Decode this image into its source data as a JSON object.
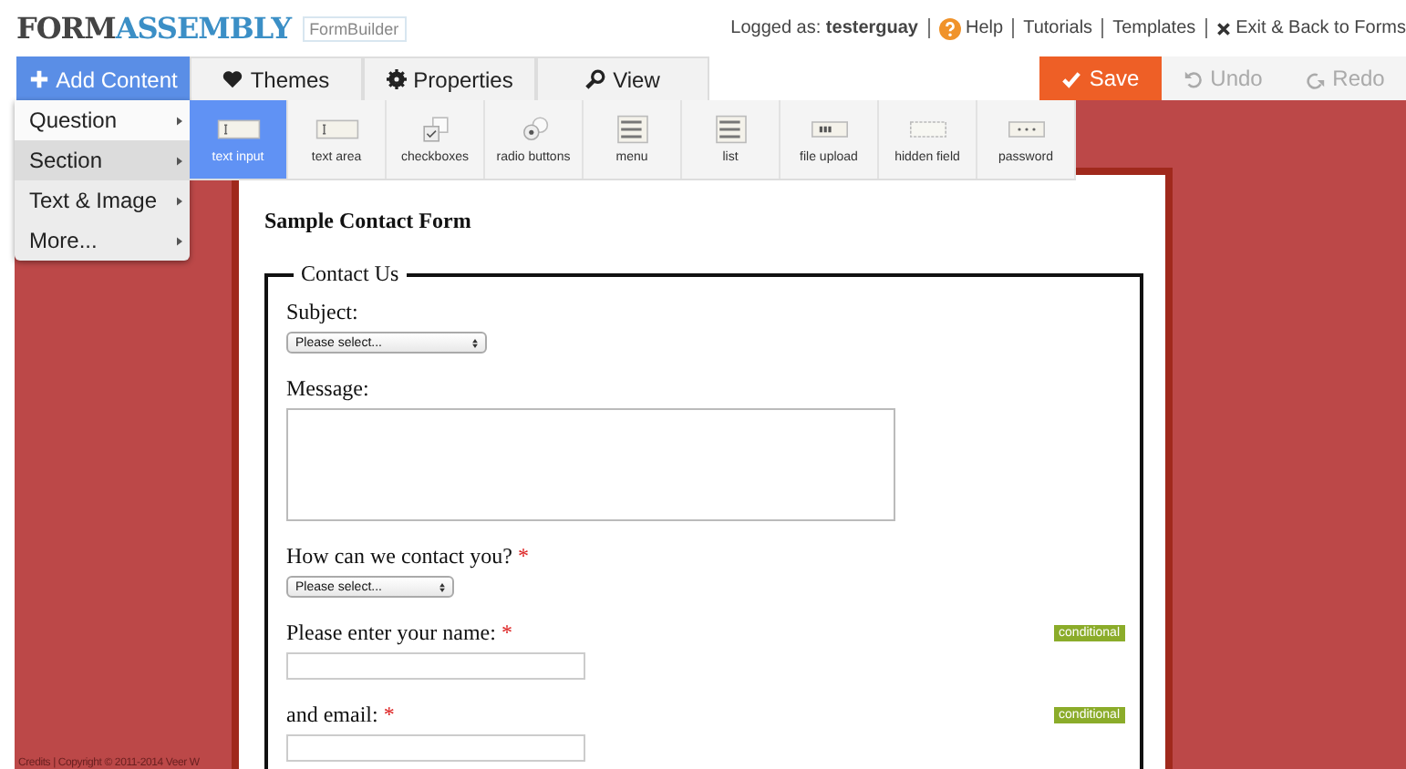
{
  "header": {
    "logo": {
      "dark": "FORM",
      "blue": "ASSEMBLY"
    },
    "product": "FormBuilder",
    "logged_as": "Logged as:",
    "username": "testerguay",
    "links": [
      {
        "label": "Help",
        "kind": "help"
      },
      {
        "label": "Tutorials",
        "kind": "plain"
      },
      {
        "label": "Templates",
        "kind": "plain"
      },
      {
        "label": "Exit & Back to Forms",
        "kind": "exit"
      }
    ]
  },
  "tabs": [
    {
      "label": "Add Content",
      "kind": "plus",
      "selected": true
    },
    {
      "label": "Themes",
      "kind": "heart",
      "selected": false
    },
    {
      "label": "Properties",
      "kind": "gear",
      "selected": false
    },
    {
      "label": "View",
      "kind": "search",
      "selected": false
    }
  ],
  "actions": [
    {
      "label": "Save",
      "kind": "check",
      "disabled": false
    },
    {
      "label": "Undo",
      "kind": "undo",
      "disabled": true
    },
    {
      "label": "Redo",
      "kind": "redo",
      "disabled": true
    }
  ],
  "menu": [
    {
      "label": "Question",
      "selected": false
    },
    {
      "label": "Section",
      "selected": true
    },
    {
      "label": "Text & Image",
      "selected": false
    },
    {
      "label": "More...",
      "selected": false
    }
  ],
  "palette": [
    {
      "label": "text input",
      "kind": "textinput",
      "selected": true
    },
    {
      "label": "text area",
      "kind": "textarea",
      "selected": false
    },
    {
      "label": "checkboxes",
      "kind": "checkboxes",
      "selected": false
    },
    {
      "label": "radio buttons",
      "kind": "radio",
      "selected": false
    },
    {
      "label": "menu",
      "kind": "menu",
      "selected": false
    },
    {
      "label": "list",
      "kind": "list",
      "selected": false
    },
    {
      "label": "file upload",
      "kind": "upload",
      "selected": false
    },
    {
      "label": "hidden field",
      "kind": "hidden",
      "selected": false
    },
    {
      "label": "password",
      "kind": "password",
      "selected": false
    }
  ],
  "form": {
    "title": "Sample Contact Form",
    "legend": "Contact Us",
    "fields": [
      {
        "label": "Subject:",
        "kind": "select",
        "value": "Please select..."
      },
      {
        "label": "Message:",
        "kind": "textarea"
      },
      {
        "label": "How can we contact you?",
        "required_mark": "*",
        "kind": "select",
        "value": "Please select..."
      },
      {
        "label": "Please enter your name:",
        "required_mark": "*",
        "kind": "text",
        "conditional": "conditional"
      },
      {
        "label": "and email:",
        "required_mark": "*",
        "kind": "text",
        "conditional": "conditional"
      }
    ]
  },
  "credits": "Credits | Copyright © 2011-2014 Veer W"
}
